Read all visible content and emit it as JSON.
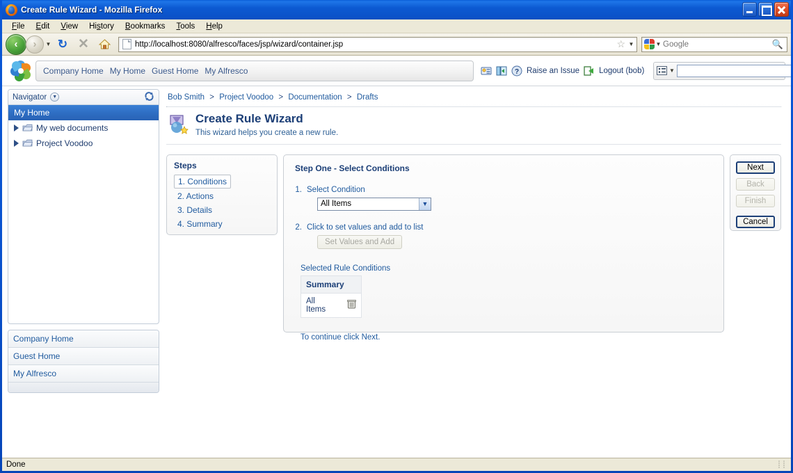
{
  "window": {
    "title": "Create Rule Wizard - Mozilla Firefox",
    "app_icon": "firefox-icon",
    "minimize_label": "",
    "maximize_label": "",
    "close_label": ""
  },
  "menubar": {
    "items": [
      {
        "label": "File",
        "accel": "F"
      },
      {
        "label": "Edit",
        "accel": "E"
      },
      {
        "label": "View",
        "accel": "V"
      },
      {
        "label": "History",
        "accel": "s"
      },
      {
        "label": "Bookmarks",
        "accel": "B"
      },
      {
        "label": "Tools",
        "accel": "T"
      },
      {
        "label": "Help",
        "accel": "H"
      }
    ]
  },
  "toolbar": {
    "back_icon": "back-arrow-icon",
    "forward_icon": "forward-arrow-icon",
    "dropdown_icon": "chevron-down-icon",
    "reload_icon": "reload-icon",
    "stop_icon": "stop-icon",
    "home_icon": "home-icon",
    "page_icon": "page-icon",
    "bookmark_icon": "star-icon",
    "url_dropdown_icon": "chevron-down-icon"
  },
  "urlbar": {
    "value": "http://localhost:8080/alfresco/faces/jsp/wizard/container.jsp"
  },
  "browser_search": {
    "engine_icon": "google-icon",
    "engine_dropdown_icon": "chevron-down-icon",
    "placeholder": "Google",
    "value": "",
    "search_icon": "magnifier-icon"
  },
  "app_header": {
    "logo_icon": "alfresco-logo-icon",
    "nav_links": [
      "Company Home",
      "My Home",
      "Guest Home",
      "My Alfresco"
    ],
    "tools": [
      {
        "icon": "user-profile-icon",
        "label": ""
      },
      {
        "icon": "shelf-icon",
        "label": ""
      },
      {
        "icon": "help-icon",
        "label": ""
      },
      {
        "icon": "",
        "label": "Raise an Issue"
      },
      {
        "icon": "logout-icon",
        "label": "Logout (bob)"
      }
    ],
    "quick_search": {
      "options_icon": "search-options-icon",
      "dropdown_icon": "chevron-down-icon",
      "value": "",
      "go_icon": "magnifier-icon"
    }
  },
  "sidebar": {
    "panel_title": "Navigator",
    "collapse_icon": "chevron-down-icon",
    "refresh_icon": "refresh-icon",
    "selected_item": "My Home",
    "tree_items": [
      {
        "label": "My web documents",
        "expand_icon": "triangle-right-icon",
        "icon": "folder-icon"
      },
      {
        "label": "Project Voodoo",
        "expand_icon": "triangle-right-icon",
        "icon": "folder-icon"
      }
    ],
    "shortcut_links": [
      "Company Home",
      "Guest Home",
      "My Alfresco"
    ]
  },
  "breadcrumb": {
    "items": [
      "Bob Smith",
      "Project Voodoo",
      "Documentation",
      "Drafts"
    ],
    "separator": ">"
  },
  "page": {
    "icon": "wizard-icon",
    "title": "Create Rule Wizard",
    "subtitle": "This wizard helps you create a new rule."
  },
  "steps_panel": {
    "title": "Steps",
    "steps": [
      {
        "label": "1. Conditions",
        "active": true
      },
      {
        "label": "2. Actions",
        "active": false
      },
      {
        "label": "3. Details",
        "active": false
      },
      {
        "label": "4. Summary",
        "active": false
      }
    ]
  },
  "main_panel": {
    "heading": "Step One - Select Conditions",
    "field1": {
      "number": "1.",
      "label": "Select Condition",
      "selected_value": "All Items",
      "dropdown_icon": "chevron-down-icon",
      "options": [
        "All Items"
      ]
    },
    "field2": {
      "number": "2.",
      "label": "Click to set values and add to list",
      "button_label": "Set Values and Add",
      "button_disabled": true
    },
    "table": {
      "caption": "Selected Rule Conditions",
      "columns": [
        "Summary"
      ],
      "rows": [
        {
          "summary": "All Items",
          "delete_icon": "trash-icon"
        }
      ]
    },
    "footer_message": "To continue click Next."
  },
  "wizard_buttons": [
    {
      "label": "Next",
      "state": "primary"
    },
    {
      "label": "Back",
      "state": "disabled"
    },
    {
      "label": "Finish",
      "state": "disabled"
    },
    {
      "label": "Cancel",
      "state": "enabled"
    }
  ],
  "statusbar": {
    "text": "Done",
    "grip_icon": "resize-grip-icon"
  },
  "colors": {
    "title_bar_blue": "#0a53cf",
    "accent_blue": "#1c3f77",
    "link_blue": "#1f5a9e",
    "selection_blue": "#2f6fc4",
    "chrome_beige": "#ece9d8",
    "close_red": "#e2512a"
  }
}
